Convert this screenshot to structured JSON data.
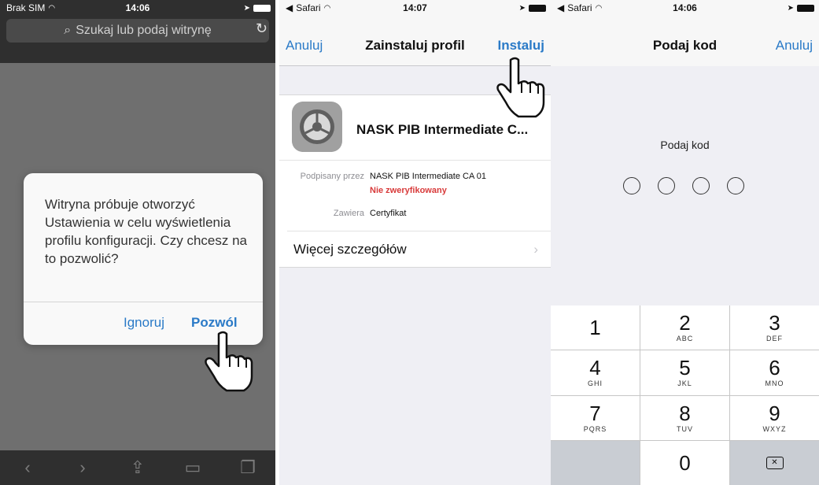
{
  "panel1": {
    "status": {
      "carrier": "Brak SIM",
      "time": "14:06"
    },
    "url_placeholder": "Szukaj lub podaj witrynę",
    "alert": {
      "message": "Witryna próbuje otworzyć Ustawienia w celu wyświetlenia profilu konfiguracji. Czy chcesz na to pozwolić?",
      "ignore_label": "Ignoruj",
      "allow_label": "Pozwól"
    }
  },
  "panel2": {
    "status": {
      "carrier": "Safari",
      "time": "14:07"
    },
    "nav": {
      "cancel_label": "Anuluj",
      "title": "Zainstaluj profil",
      "install_label": "Instaluj"
    },
    "profile": {
      "name": "NASK PIB Intermediate C...",
      "signed_by_label": "Podpisany przez",
      "signed_by_value": "NASK PIB Intermediate CA 01",
      "verification": "Nie zweryfikowany",
      "contains_label": "Zawiera",
      "contains_value": "Certyfikat",
      "more_label": "Więcej szczegółów"
    }
  },
  "panel3": {
    "status": {
      "carrier": "Safari",
      "time": "14:06"
    },
    "nav": {
      "title": "Podaj kod",
      "cancel_label": "Anuluj"
    },
    "prompt": "Podaj kod",
    "keypad": [
      {
        "digit": "1",
        "letters": ""
      },
      {
        "digit": "2",
        "letters": "ABC"
      },
      {
        "digit": "3",
        "letters": "DEF"
      },
      {
        "digit": "4",
        "letters": "GHI"
      },
      {
        "digit": "5",
        "letters": "JKL"
      },
      {
        "digit": "6",
        "letters": "MNO"
      },
      {
        "digit": "7",
        "letters": "PQRS"
      },
      {
        "digit": "8",
        "letters": "TUV"
      },
      {
        "digit": "9",
        "letters": "WXYZ"
      }
    ],
    "zero": "0"
  },
  "colors": {
    "ios_blue": "#2a7ac7",
    "warning_red": "#d83a3a"
  }
}
